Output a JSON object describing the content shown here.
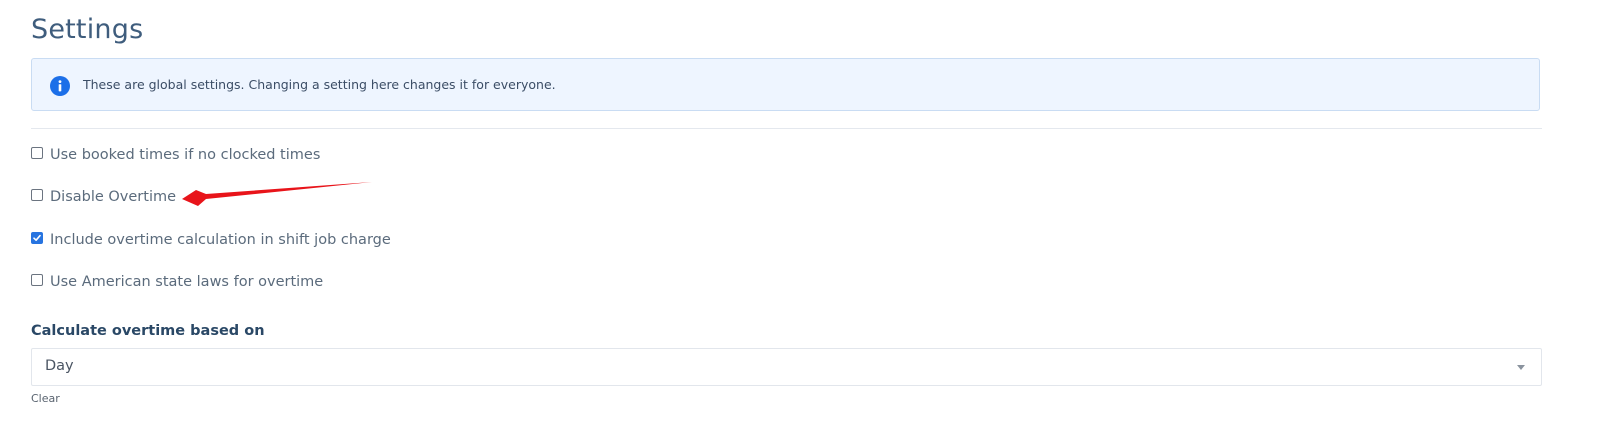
{
  "page": {
    "title": "Settings"
  },
  "alert": {
    "icon": "info-icon",
    "text": "These are global settings. Changing a setting here changes it for everyone."
  },
  "options": [
    {
      "label": "Use booked times if no clocked times",
      "checked": false
    },
    {
      "label": "Disable Overtime",
      "checked": false
    },
    {
      "label": "Include overtime calculation in shift job charge",
      "checked": true
    },
    {
      "label": "Use American state laws for overtime",
      "checked": false
    }
  ],
  "overtime_basis": {
    "label": "Calculate overtime based on",
    "selected": "Day",
    "clear_label": "Clear"
  },
  "colors": {
    "accent": "#2774e0",
    "title": "#3f5d7d",
    "alert_bg": "#eef5ff",
    "annotation_arrow": "#e8141a"
  }
}
